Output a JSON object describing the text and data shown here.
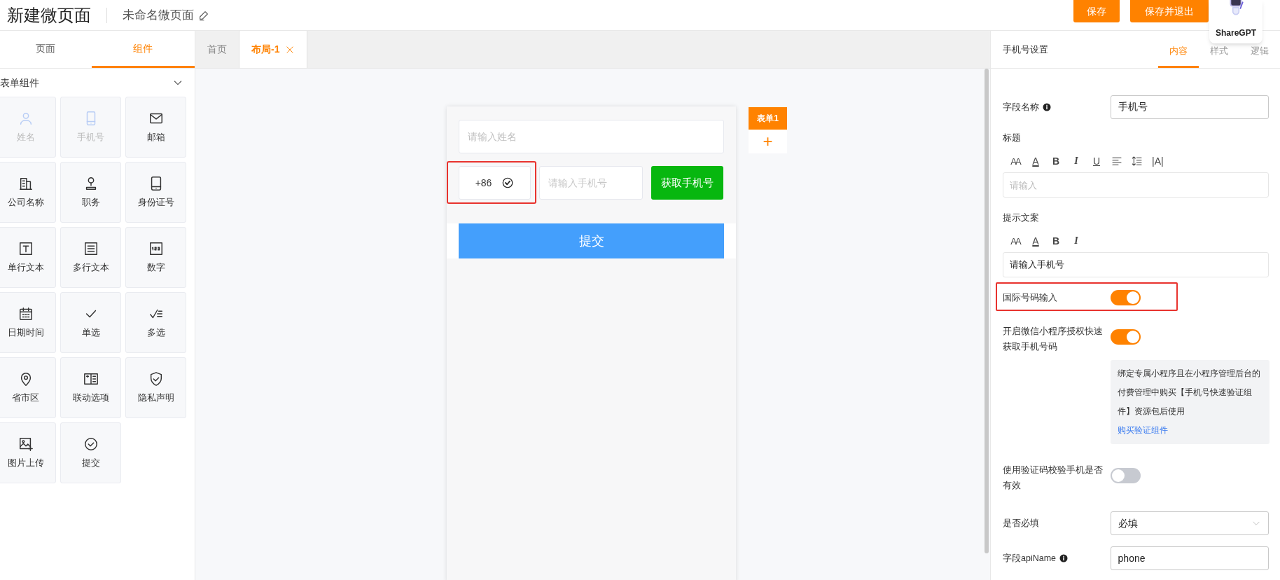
{
  "header": {
    "title": "新建微页面",
    "page_name": "未命名微页面",
    "buttons": [
      "保存",
      "保存并退出"
    ]
  },
  "extension_badge": {
    "label": "ShareGPT"
  },
  "left_panel": {
    "tabs": [
      {
        "label": "页面",
        "selected": false
      },
      {
        "label": "组件",
        "selected": true
      }
    ],
    "section": {
      "title": "表单组件",
      "expanded": true
    },
    "components": [
      {
        "label": "姓名",
        "disabled": true
      },
      {
        "label": "手机号",
        "disabled": true
      },
      {
        "label": "邮箱",
        "disabled": false
      },
      {
        "label": "公司名称",
        "disabled": false
      },
      {
        "label": "职务",
        "disabled": false
      },
      {
        "label": "身份证号",
        "disabled": false
      },
      {
        "label": "单行文本",
        "disabled": false
      },
      {
        "label": "多行文本",
        "disabled": false
      },
      {
        "label": "数字",
        "disabled": false
      },
      {
        "label": "日期时间",
        "disabled": false
      },
      {
        "label": "单选",
        "disabled": false
      },
      {
        "label": "多选",
        "disabled": false
      },
      {
        "label": "省市区",
        "disabled": false
      },
      {
        "label": "联动选项",
        "disabled": false
      },
      {
        "label": "隐私声明",
        "disabled": false
      },
      {
        "label": "图片上传",
        "disabled": false
      },
      {
        "label": "提交",
        "disabled": false
      }
    ]
  },
  "editor_tabs": [
    {
      "label": "首页",
      "selected": false,
      "closable": false
    },
    {
      "label": "布局-1",
      "selected": true,
      "closable": true
    }
  ],
  "form_preview": {
    "name_placeholder": "请输入姓名",
    "country_code": "+86",
    "country_code_highlighted": true,
    "phone_placeholder": "请输入手机号",
    "get_phone_button": "获取手机号",
    "submit_button": "提交",
    "form_tag": "表单1",
    "add_symbol": "+"
  },
  "settings": {
    "title": "手机号设置",
    "tabs": [
      {
        "label": "内容",
        "selected": true
      },
      {
        "label": "样式",
        "selected": false
      },
      {
        "label": "逻辑",
        "selected": false
      }
    ],
    "rows": [
      {
        "kind": "input",
        "label": "字段名称",
        "info": true,
        "value": "手机号"
      },
      {
        "kind": "rich",
        "label": "标题",
        "placeholder": "请输入",
        "tools": [
          {
            "kind": "font_size",
            "label": "AA"
          },
          {
            "kind": "font_color",
            "label": "A"
          },
          {
            "kind": "bold",
            "label": "B"
          },
          {
            "kind": "italic",
            "label": "I"
          },
          {
            "kind": "underline",
            "label": "U"
          },
          {
            "kind": "align"
          },
          {
            "kind": "line_height"
          },
          {
            "kind": "letter_spacing",
            "label": "|A|"
          }
        ]
      },
      {
        "kind": "rich",
        "label": "提示文案",
        "value": "请输入手机号",
        "tools": [
          {
            "kind": "font_size",
            "label": "AA"
          },
          {
            "kind": "font_color",
            "label": "A"
          },
          {
            "kind": "bold",
            "label": "B"
          },
          {
            "kind": "italic",
            "label": "I"
          }
        ]
      },
      {
        "kind": "switch",
        "label": "国际号码输入",
        "on": true,
        "highlighted": true
      },
      {
        "kind": "switch",
        "label": "开启微信小程序授权快速获取手机号码",
        "on": true,
        "highlighted": false,
        "note": {
          "text": "绑定专属小程序且在小程序管理后台的付费管理中购买【手机号快速验证组件】资源包后使用",
          "link": "购买验证组件"
        }
      },
      {
        "kind": "switch",
        "label": "使用验证码校验手机是否有效",
        "on": false,
        "highlighted": false
      },
      {
        "kind": "select",
        "label": "是否必填",
        "value": "必填"
      },
      {
        "kind": "input",
        "label": "字段apiName",
        "info": true,
        "value": "phone"
      }
    ]
  }
}
